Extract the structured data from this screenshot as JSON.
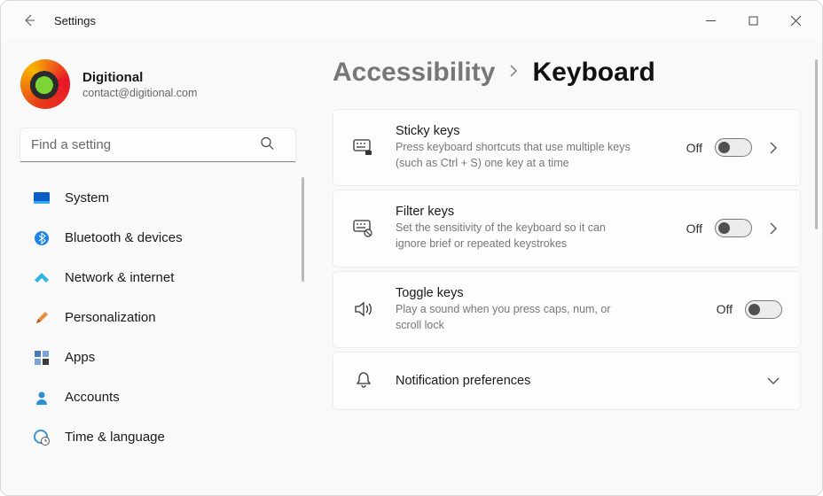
{
  "window": {
    "title": "Settings"
  },
  "profile": {
    "name": "Digitional",
    "email": "contact@digitional.com"
  },
  "search": {
    "placeholder": "Find a setting"
  },
  "sidebar": {
    "items": [
      {
        "label": "System"
      },
      {
        "label": "Bluetooth & devices"
      },
      {
        "label": "Network & internet"
      },
      {
        "label": "Personalization"
      },
      {
        "label": "Apps"
      },
      {
        "label": "Accounts"
      },
      {
        "label": "Time & language"
      }
    ]
  },
  "breadcrumb": {
    "parent": "Accessibility",
    "current": "Keyboard"
  },
  "cards": [
    {
      "title": "Sticky keys",
      "desc": "Press keyboard shortcuts that use multiple keys (such as Ctrl + S) one key at a time",
      "state": "Off",
      "hasChevron": true
    },
    {
      "title": "Filter keys",
      "desc": "Set the sensitivity of the keyboard so it can ignore brief or repeated keystrokes",
      "state": "Off",
      "hasChevron": true
    },
    {
      "title": "Toggle keys",
      "desc": "Play a sound when you press caps, num, or scroll lock",
      "state": "Off",
      "hasChevron": false
    },
    {
      "title": "Notification preferences",
      "desc": "",
      "expandable": true
    }
  ]
}
